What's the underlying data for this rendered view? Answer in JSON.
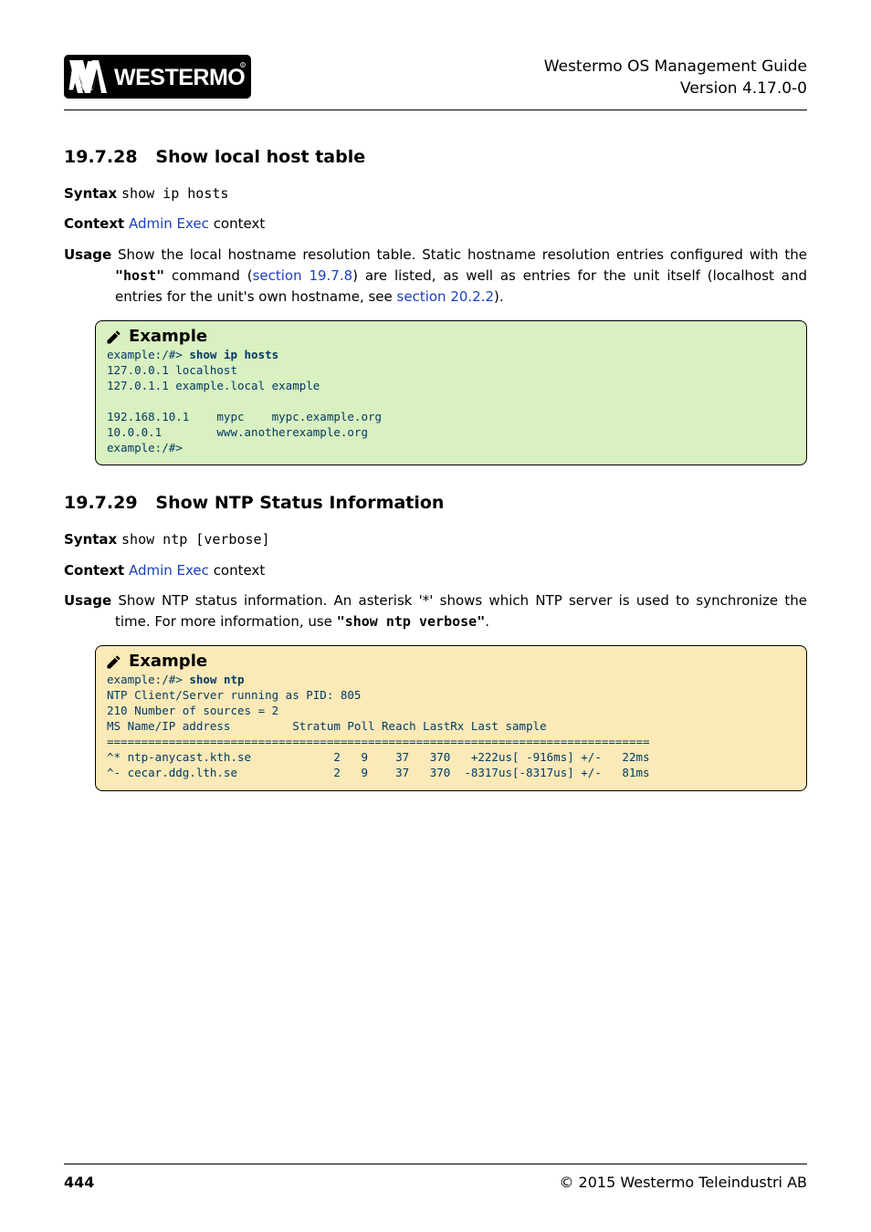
{
  "header": {
    "title_line1": "Westermo OS Management Guide",
    "title_line2": "Version 4.17.0-0"
  },
  "section1": {
    "number": "19.7.28",
    "title": "Show local host table",
    "syntax_label": "Syntax",
    "syntax_value": "show ip hosts",
    "context_label": "Context",
    "context_link": "Admin Exec",
    "context_tail": " context",
    "usage_label": "Usage",
    "usage_part1": "Show the local hostname resolution table.  Static hostname resolution entries configured with the ",
    "usage_cmd": "\"host\"",
    "usage_part2": " command (",
    "usage_link1": "section 19.7.8",
    "usage_part3": ") are listed, as well as entries for the unit itself (localhost and entries for the unit's own hostname, see ",
    "usage_link2": "section 20.2.2",
    "usage_part4": ").",
    "example_label": "Example",
    "example_prompt1": "example:/#> ",
    "example_cmd1": "show ip hosts",
    "example_body": "127.0.0.1 localhost\n127.0.1.1 example.local example\n\n192.168.10.1    mypc    mypc.example.org\n10.0.0.1        www.anotherexample.org\nexample:/#>"
  },
  "section2": {
    "number": "19.7.29",
    "title": "Show NTP Status Information",
    "syntax_label": "Syntax",
    "syntax_value": "show ntp [verbose]",
    "context_label": "Context",
    "context_link": "Admin Exec",
    "context_tail": " context",
    "usage_label": "Usage",
    "usage_part1": "Show NTP status information.  An asterisk '*' shows which NTP server is used to synchronize the time.  For more information, use ",
    "usage_cmd": "\"show ntp verbose\"",
    "usage_part2": ".",
    "example_label": "Example",
    "example_prompt1": "example:/#> ",
    "example_cmd1": "show ntp",
    "example_body": "NTP Client/Server running as PID: 805\n210 Number of sources = 2\nMS Name/IP address         Stratum Poll Reach LastRx Last sample\n===============================================================================\n^* ntp-anycast.kth.se            2   9    37   370   +222us[ -916ms] +/-   22ms\n^- cecar.ddg.lth.se              2   9    37   370  -8317us[-8317us] +/-   81ms"
  },
  "footer": {
    "page": "444",
    "copyright": "© 2015 Westermo Teleindustri AB"
  }
}
